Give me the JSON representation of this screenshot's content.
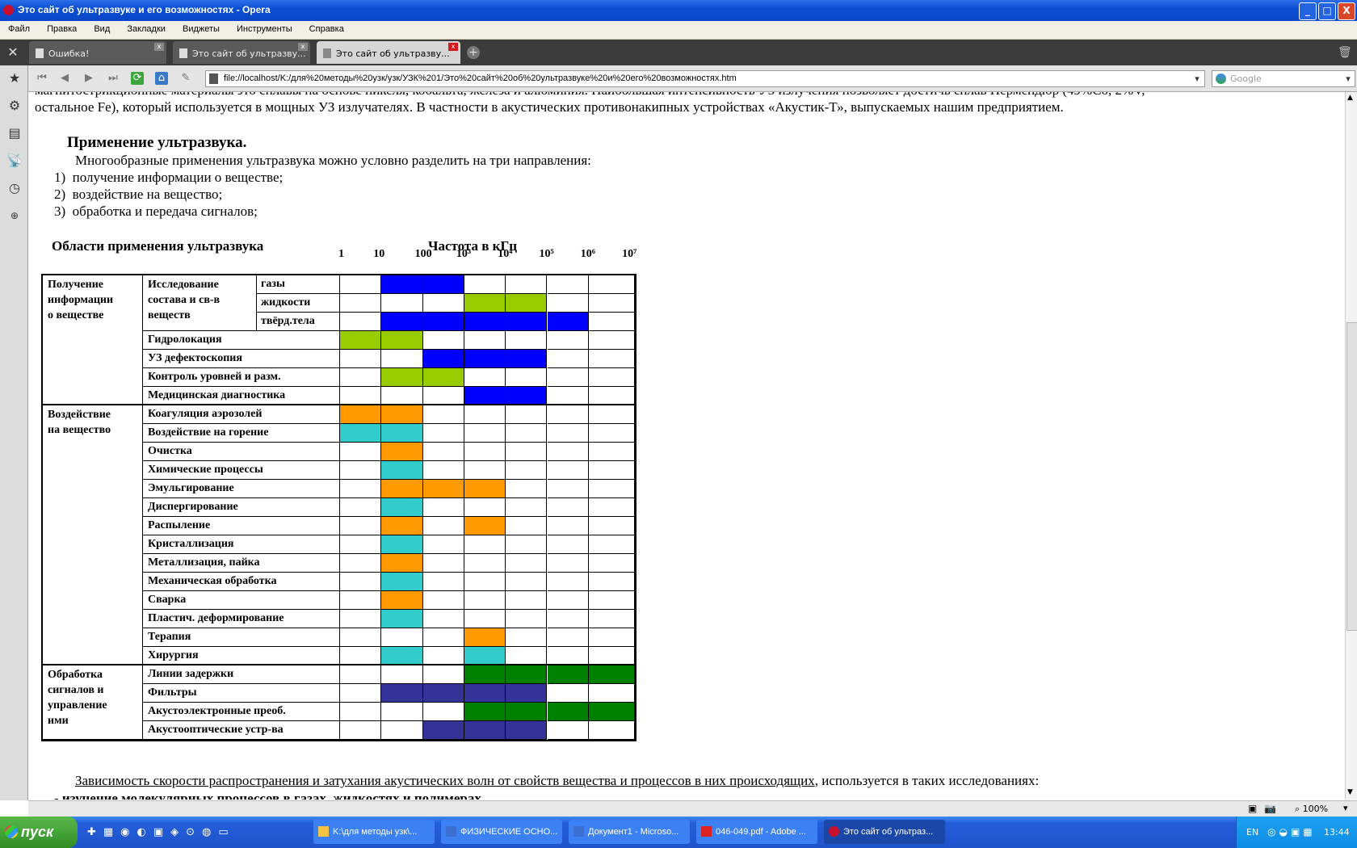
{
  "window": {
    "title": "Это сайт об ультразвуке  и его возможностях - Opera",
    "min": "_",
    "max": "□",
    "close": "X"
  },
  "menu": [
    "Файл",
    "Правка",
    "Вид",
    "Закладки",
    "Виджеты",
    "Инструменты",
    "Справка"
  ],
  "tabs": [
    {
      "label": "Ошибка!"
    },
    {
      "label": "Это сайт об ультразву..."
    },
    {
      "label": "Это сайт об ультразву..."
    }
  ],
  "address": {
    "url": "file://localhost/K:/для%20методы%20узк/узк/УЗК%201/Это%20сайт%20об%20ультразвуке%20и%20его%20возможностях.htm",
    "search_placeholder": "Google"
  },
  "article": {
    "top_line": "магнитострикционные материалы это сплавы на основе никеля, кобальта, железа и алюминия. Наибольшая интенсивность УЗ излучения позволяет достичь сплав Пермендюр (49%Co, 2%V,",
    "top_line2": "остальное Fe), который используется в мощных УЗ излучателях. В частности в акустических противонакипных устройствах «Акустик-Т», выпускаемых нашим предприятием.",
    "heading": "Применение ультразвука.",
    "intro": "Многообразные применения ультразвука можно условно разделить на три направления:",
    "list": [
      {
        "num": "1)",
        "text": "получение информации о веществе;"
      },
      {
        "num": "2)",
        "text": "воздействие на вещество;"
      },
      {
        "num": "3)",
        "text": "обработка и передача сигналов;"
      }
    ],
    "bottom_para_underlined": "Зависимость скорости распространения и затухания акустических волн от свойств вещества и процессов в них происходящих",
    "bottom_para_rest": ", используется в таких исследованиях:",
    "bottom_item": "- изучение молекулярных процессов в газах, жидкостях и полимерах."
  },
  "chart_data": {
    "type": "table",
    "title_left": "Области применения ультразвука",
    "title_right": "Частота в кГц",
    "freq_ticks": [
      "1",
      "10",
      "100",
      "10³",
      "10⁴",
      "10⁵",
      "10⁶",
      "10⁷"
    ],
    "colors": {
      "blue": "#0000ff",
      "green_yellow": "#99cc00",
      "orange": "#ff9900",
      "cyan": "#33cccc",
      "indigo": "#333399",
      "green": "#008000"
    },
    "groups": [
      {
        "name": "Получение информации о веществе",
        "name_lines": [
          "Получение",
          "информации",
          "о веществе"
        ]
      },
      {
        "name": "Воздействие на вещество",
        "name_lines": [
          "Воздействие",
          "на вещество"
        ]
      },
      {
        "name": "Обработка сигналов и управление ими",
        "name_lines": [
          "Обработка",
          "сигналов и",
          "управление",
          "ими"
        ]
      }
    ],
    "subgroup": {
      "name_lines": [
        "Исследование",
        "состава  и св-в",
        "веществ"
      ]
    },
    "rows": [
      {
        "group": 0,
        "label": "газы",
        "sub": true,
        "filled": [
          1,
          2
        ],
        "color": "blue"
      },
      {
        "group": 0,
        "label": "жидкости",
        "sub": true,
        "filled": [
          3,
          4
        ],
        "color": "green_yellow"
      },
      {
        "group": 0,
        "label": "твёрд.тела",
        "sub": true,
        "filled": [
          1,
          2,
          3,
          4,
          5
        ],
        "color": "blue"
      },
      {
        "group": 0,
        "label": "Гидролокация",
        "filled": [
          0,
          1
        ],
        "color": "green_yellow"
      },
      {
        "group": 0,
        "label": "УЗ дефектоскопия",
        "filled": [
          2,
          3,
          4
        ],
        "color": "blue"
      },
      {
        "group": 0,
        "label": "Контроль уровней и разм.",
        "filled": [
          1,
          2
        ],
        "color": "green_yellow"
      },
      {
        "group": 0,
        "label": "Медицинская диагностика",
        "filled": [
          3,
          4
        ],
        "color": "blue"
      },
      {
        "group": 1,
        "label": "Коагуляция аэрозолей",
        "filled": [
          0,
          1
        ],
        "color": "orange"
      },
      {
        "group": 1,
        "label": "Воздействие на горение",
        "filled": [
          0,
          1
        ],
        "color": "cyan"
      },
      {
        "group": 1,
        "label": "Очистка",
        "filled": [
          1
        ],
        "color": "orange"
      },
      {
        "group": 1,
        "label": "Химические процессы",
        "filled": [
          1
        ],
        "color": "cyan"
      },
      {
        "group": 1,
        "label": "Эмульгирование",
        "filled": [
          1,
          2,
          3
        ],
        "color": "orange"
      },
      {
        "group": 1,
        "label": "Диспергирование",
        "filled": [
          1
        ],
        "color": "cyan"
      },
      {
        "group": 1,
        "label": "Распыление",
        "filled": [
          1,
          3
        ],
        "color": "orange"
      },
      {
        "group": 1,
        "label": "Кристаллизация",
        "filled": [
          1
        ],
        "color": "cyan"
      },
      {
        "group": 1,
        "label": "Металлизация, пайка",
        "filled": [
          1
        ],
        "color": "orange"
      },
      {
        "group": 1,
        "label": "Механическая обработка",
        "filled": [
          1
        ],
        "color": "cyan"
      },
      {
        "group": 1,
        "label": "Сварка",
        "filled": [
          1
        ],
        "color": "orange"
      },
      {
        "group": 1,
        "label": "Пластич. деформирование",
        "filled": [
          1
        ],
        "color": "cyan"
      },
      {
        "group": 1,
        "label": "Терапия",
        "filled": [
          3
        ],
        "color": "orange"
      },
      {
        "group": 1,
        "label": "Хирургия",
        "filled": [
          1,
          3
        ],
        "color": "cyan"
      },
      {
        "group": 2,
        "label": "Линии задержки",
        "filled": [
          3,
          4,
          5,
          6
        ],
        "color": "green"
      },
      {
        "group": 2,
        "label": "Фильтры",
        "filled": [
          1,
          2,
          3,
          4
        ],
        "color": "indigo"
      },
      {
        "group": 2,
        "label": "Акустоэлектронные преоб.",
        "filled": [
          3,
          4,
          5,
          6
        ],
        "color": "green"
      },
      {
        "group": 2,
        "label": "Акустооптические устр-ва",
        "filled": [
          2,
          3,
          4
        ],
        "color": "indigo"
      }
    ]
  },
  "status": {
    "zoom": "100%"
  },
  "taskbar": {
    "start": "пуск",
    "tasks": [
      {
        "label": "K:\\для методы узк\\..."
      },
      {
        "label": "ФИЗИЧЕСКИЕ ОСНО..."
      },
      {
        "label": "Документ1 - Microso..."
      },
      {
        "label": "046-049.pdf - Adobe ..."
      },
      {
        "label": "Это сайт об ультраз..."
      }
    ],
    "lang": "EN",
    "clock": "13:44"
  }
}
